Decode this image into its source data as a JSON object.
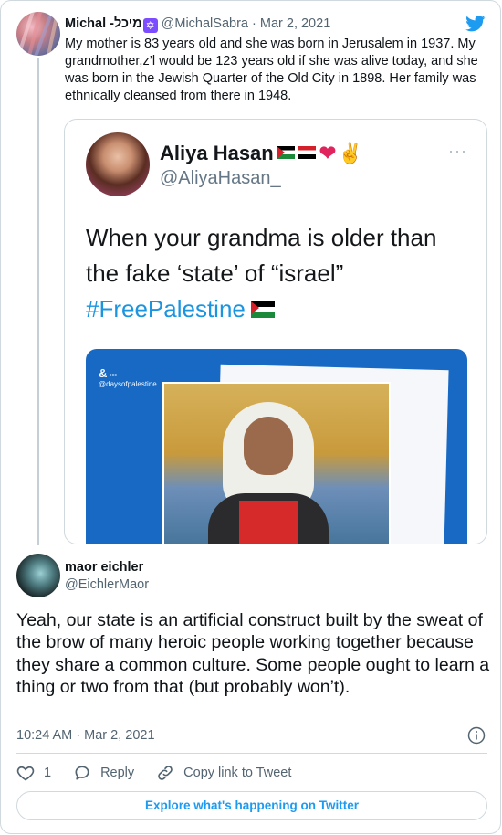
{
  "parent_tweet": {
    "author_name": "Michal -מיכל",
    "author_badge": "✡",
    "handle": "@MichalSabra",
    "separator": "·",
    "date": "Mar 2, 2021",
    "text": "My mother is 83 years old and she was born in Jerusalem in 1937. My grandmother,z’l would be 123 years old if she was alive today, and she was born in the Jewish Quarter of the Old City in 1898. Her family was ethnically cleansed from there in 1948."
  },
  "embedded_image": {
    "author_name": "Aliya Hasan",
    "handle": "@AliyaHasan_",
    "more": "···",
    "text_line1": "When your grandma is older than",
    "text_line2": "the fake ‘state’ of “israel”",
    "hashtag": "#FreePalestine",
    "photo_logo_line1": "&",
    "photo_logo_line2": "@daysofpalestine"
  },
  "main_tweet": {
    "author_name": "maor eichler",
    "handle": "@EichlerMaor",
    "text": "Yeah, our state is an artificial construct built by the sweat of the brow of many heroic people working together because they share a common culture. Some people ought to learn a thing or two from that (but probably won’t).",
    "timestamp": "10:24 AM · Mar 2, 2021"
  },
  "actions": {
    "like_count": "1",
    "reply_label": "Reply",
    "copy_link_label": "Copy link to Tweet"
  },
  "explore_label": "Explore what's happening on Twitter",
  "colors": {
    "twitter_blue": "#1d9bf0",
    "text_primary": "#0f1419",
    "text_secondary": "#536471",
    "border": "#cfd9de"
  }
}
